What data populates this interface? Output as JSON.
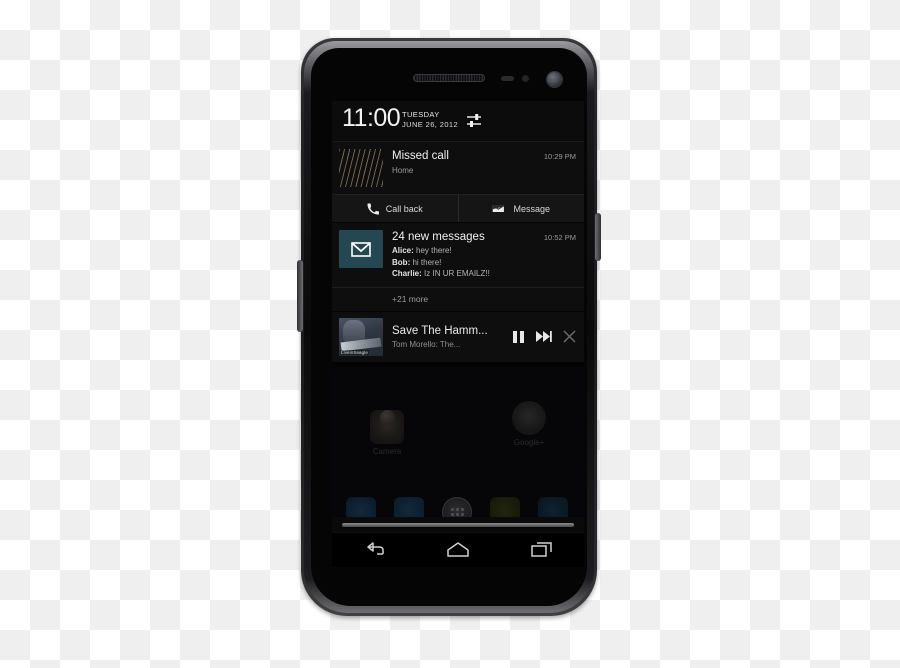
{
  "device": {
    "name": "Galaxy Nexus phone",
    "hardware": {
      "earpiece": "earpiece-speaker",
      "front_camera": "front-camera",
      "proximity_sensor": "proximity-sensor",
      "power_button": "power-button",
      "volume_button": "volume-rocker"
    }
  },
  "status_bar": {
    "time": "11:00",
    "day_of_week": "TUESDAY",
    "date": "JUNE 26, 2012",
    "settings_icon": "settings-sliders-icon"
  },
  "notifications": [
    {
      "id": "missed-call",
      "title": "Missed call",
      "subtitle": "Home",
      "time": "10:29 PM",
      "thumbnail": "contact-photo",
      "actions": [
        {
          "label": "Call back",
          "icon": "phone-icon"
        },
        {
          "label": "Message",
          "icon": "message-icon"
        }
      ]
    },
    {
      "id": "gmail",
      "title": "24 new messages",
      "time": "10:52 PM",
      "icon": "gmail-envelope-icon",
      "icon_background": "#254752",
      "messages": [
        {
          "sender": "Alice",
          "text": "hey there!"
        },
        {
          "sender": "Bob",
          "text": "hi there!"
        },
        {
          "sender": "Charlie",
          "text": "Iz IN UR EMAILZ!!"
        }
      ],
      "more_label": "+21 more"
    },
    {
      "id": "music-player",
      "title": "Save The Hamm...",
      "artist": "Tom Morello: The...",
      "album_art": "album-art-guitarist",
      "album_watermark": "LiveinSeagle",
      "controls": [
        {
          "name": "pause-button",
          "icon": "pause-icon"
        },
        {
          "name": "next-track-button",
          "icon": "next-track-icon"
        },
        {
          "name": "dismiss-button",
          "icon": "close-icon"
        }
      ]
    }
  ],
  "shade": {
    "drag_handle": "notification-shade-drag-handle"
  },
  "home_screen": {
    "icons": [
      {
        "label": "Camera",
        "name": "camera-app-icon"
      },
      {
        "label": "Google+",
        "name": "google-plus-app-icon"
      }
    ],
    "dock": [
      "phone-dock-icon",
      "contacts-dock-icon",
      "all-apps-dock-icon",
      "messaging-dock-icon",
      "browser-dock-icon"
    ]
  },
  "nav_bar": {
    "buttons": [
      {
        "name": "back-button",
        "icon": "back-arrow-icon"
      },
      {
        "name": "home-button",
        "icon": "home-icon"
      },
      {
        "name": "recents-button",
        "icon": "recent-apps-icon"
      }
    ]
  }
}
